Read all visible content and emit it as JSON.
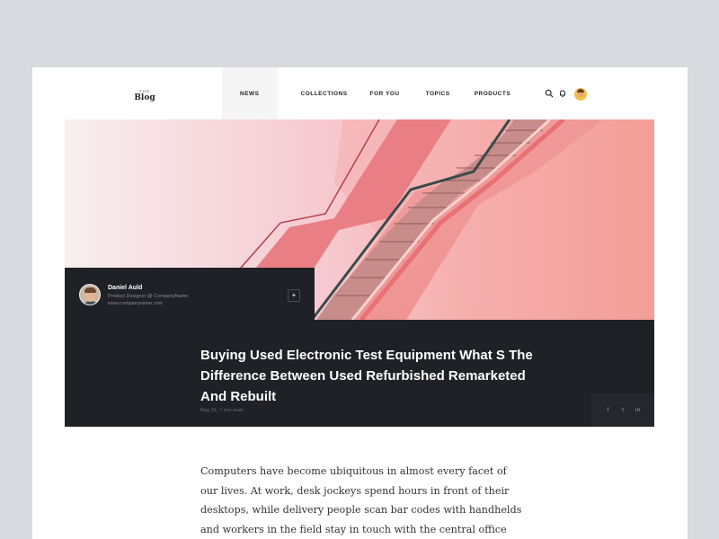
{
  "logo": {
    "small": "THE",
    "name": "Blog"
  },
  "nav": {
    "items": [
      {
        "label": "NEWS"
      },
      {
        "label": "COLLECTIONS"
      },
      {
        "label": "FOR YOU"
      },
      {
        "label": "TOPICS"
      },
      {
        "label": "PRODUCTS"
      }
    ],
    "active": "NEWS"
  },
  "header_icons": [
    "search-icon",
    "bell-icon",
    "user-avatar"
  ],
  "author": {
    "name": "Daniel Auld",
    "role": "Product Designer @ CompanyName",
    "website": "www.companyname.com",
    "follow_label": "+"
  },
  "article": {
    "title": "Buying Used Electronic Test Equipment What S The Difference Between Used Refurbished Remarketed And Rebuilt",
    "meta": "May 31, 7 min read",
    "share_icons": [
      {
        "name": "facebook-icon",
        "glyph": "f"
      },
      {
        "name": "twitter-icon",
        "glyph": "t"
      },
      {
        "name": "linkedin-icon",
        "glyph": "in"
      }
    ],
    "body": "Computers have become ubiquitous in almost every facet of our lives. At work, desk jockeys spend hours in front of their desktops, while delivery people scan bar codes with handhelds and workers in the field stay in touch with the central office via their"
  },
  "colors": {
    "dark": "#1f2127",
    "accent_pink": "#f28b7e",
    "background": "#d9dadf"
  }
}
